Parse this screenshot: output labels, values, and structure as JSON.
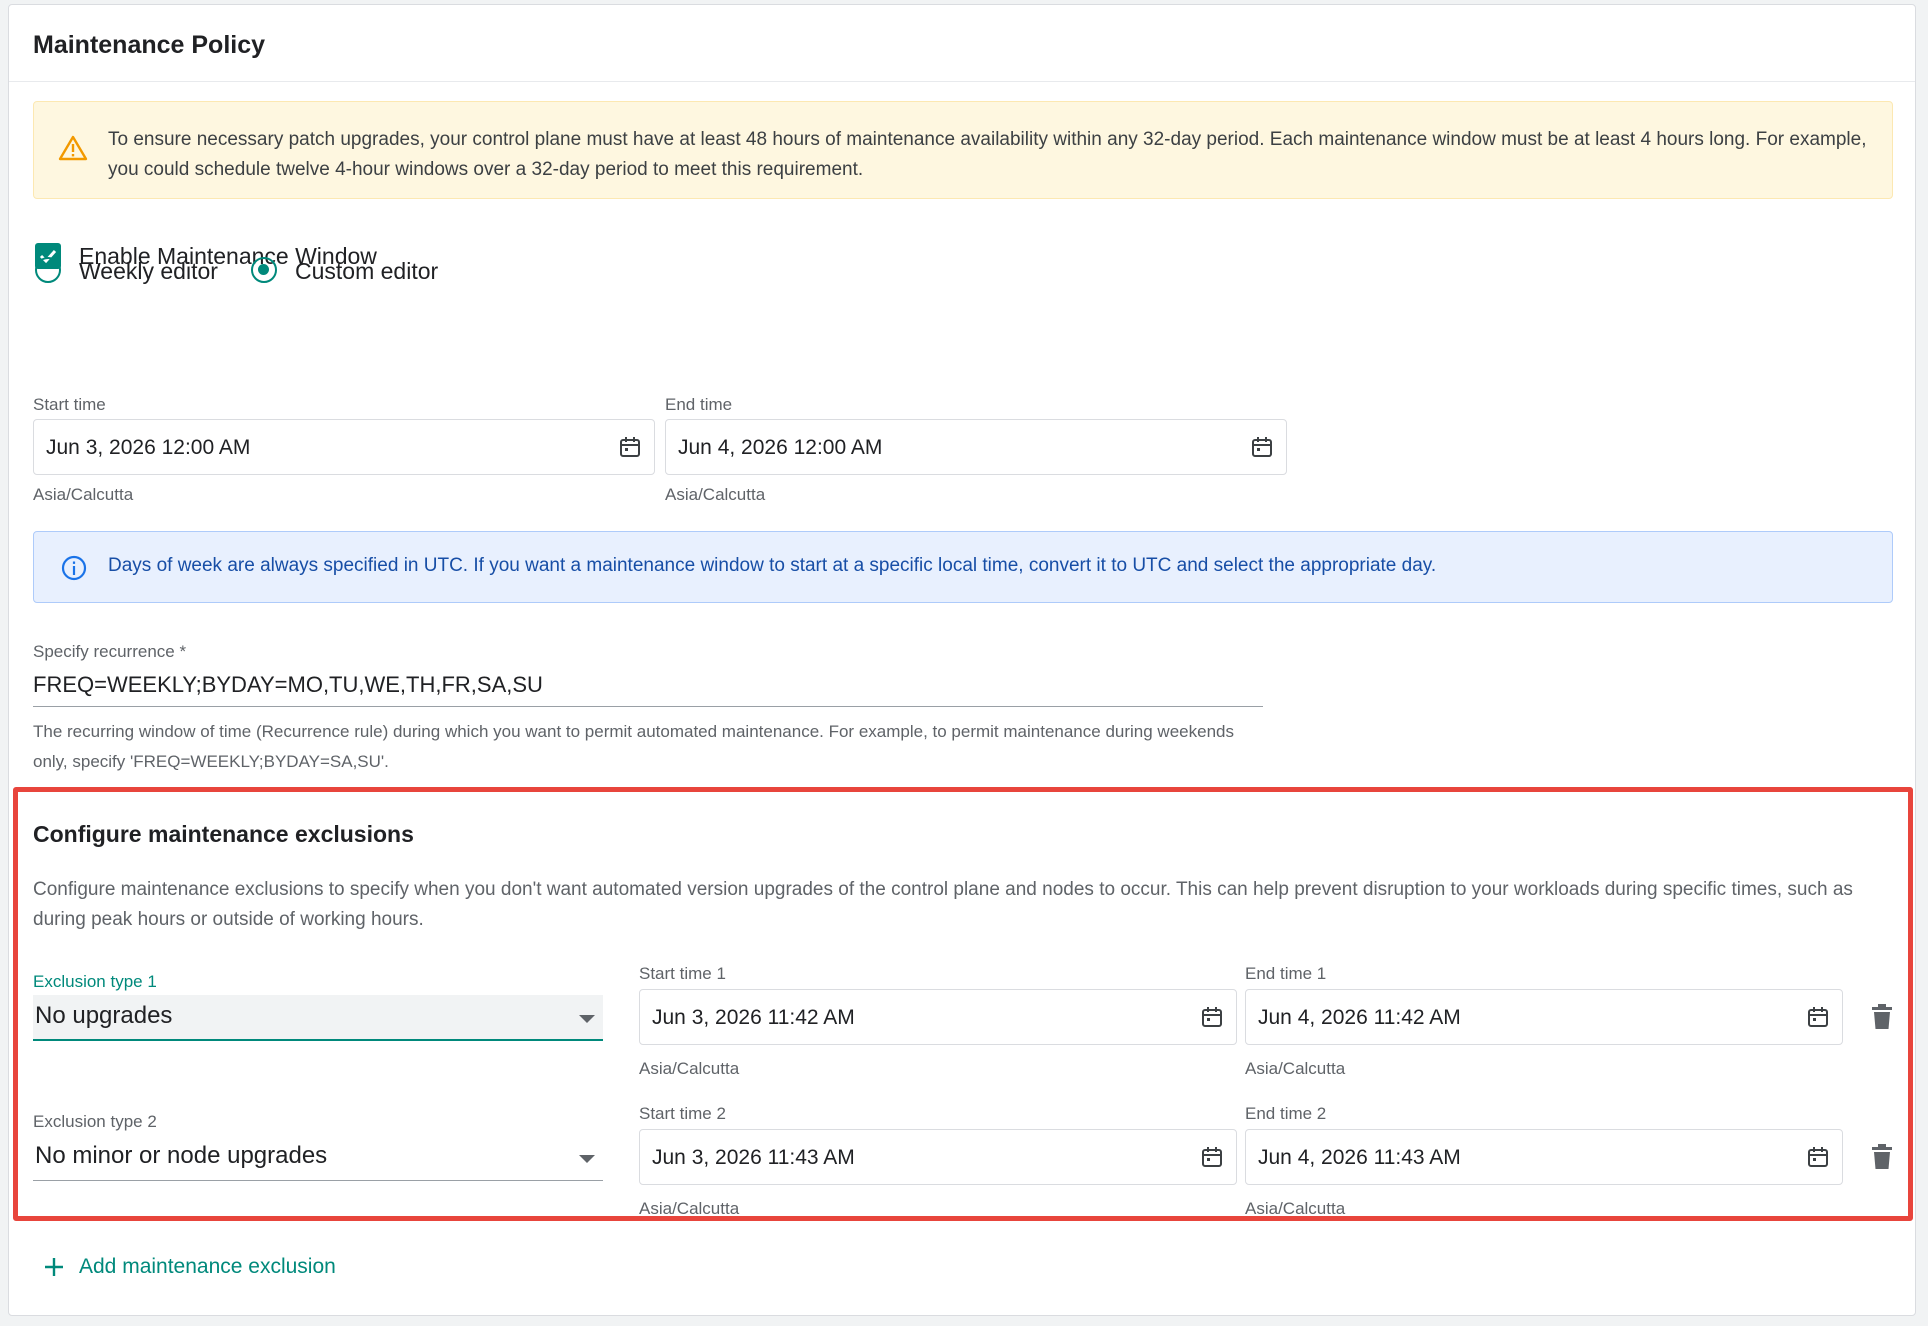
{
  "card": {
    "title": "Maintenance Policy"
  },
  "warning": {
    "text": "To ensure necessary patch upgrades, your control plane must have at least 48 hours of maintenance availability within any 32-day period. Each maintenance window must be at least 4 hours long. For example, you could schedule twelve 4-hour windows over a 32-day period to meet this requirement.",
    "icon": "warning-triangle-icon"
  },
  "enable": {
    "label": "Enable Maintenance Window",
    "checked": true
  },
  "editor": {
    "options": [
      {
        "label": "Weekly editor",
        "selected": false
      },
      {
        "label": "Custom editor",
        "selected": true
      }
    ]
  },
  "window": {
    "start": {
      "label": "Start time",
      "value": "Jun 3, 2026 12:00 AM",
      "tz": "Asia/Calcutta"
    },
    "end": {
      "label": "End time",
      "value": "Jun 4, 2026 12:00 AM",
      "tz": "Asia/Calcutta"
    }
  },
  "info": {
    "text": "Days of week are always specified in UTC. If you want a maintenance window to start at a specific local time, convert it to UTC and select the appropriate day.",
    "icon": "info-circle-icon"
  },
  "recurrence": {
    "label": "Specify recurrence *",
    "value": "FREQ=WEEKLY;BYDAY=MO,TU,WE,TH,FR,SA,SU",
    "help": "The recurring window of time (Recurrence rule) during which you want to permit automated maintenance. For example, to permit maintenance during weekends only, specify 'FREQ=WEEKLY;BYDAY=SA,SU'."
  },
  "exclusions": {
    "title": "Configure maintenance exclusions",
    "description": "Configure maintenance exclusions to specify when you don't want automated version upgrades of the control plane and nodes to occur. This can help prevent disruption to your workloads during specific times, such as during peak hours or outside of working hours.",
    "items": [
      {
        "type_label": "Exclusion type 1",
        "type_value": "No upgrades",
        "start_label": "Start time 1",
        "start_value": "Jun 3, 2026 11:42 AM",
        "start_tz": "Asia/Calcutta",
        "end_label": "End time 1",
        "end_value": "Jun 4, 2026 11:42 AM",
        "end_tz": "Asia/Calcutta"
      },
      {
        "type_label": "Exclusion type 2",
        "type_value": "No minor or node upgrades",
        "start_label": "Start time 2",
        "start_value": "Jun 3, 2026 11:43 AM",
        "start_tz": "Asia/Calcutta",
        "end_label": "End time 2",
        "end_value": "Jun 4, 2026 11:43 AM",
        "end_tz": "Asia/Calcutta"
      }
    ],
    "add_label": "Add maintenance exclusion"
  },
  "colors": {
    "accent": "#00897b",
    "warning_bg": "#fef7e0",
    "info_bg": "#e8f0fe",
    "highlight": "#e8453c"
  }
}
